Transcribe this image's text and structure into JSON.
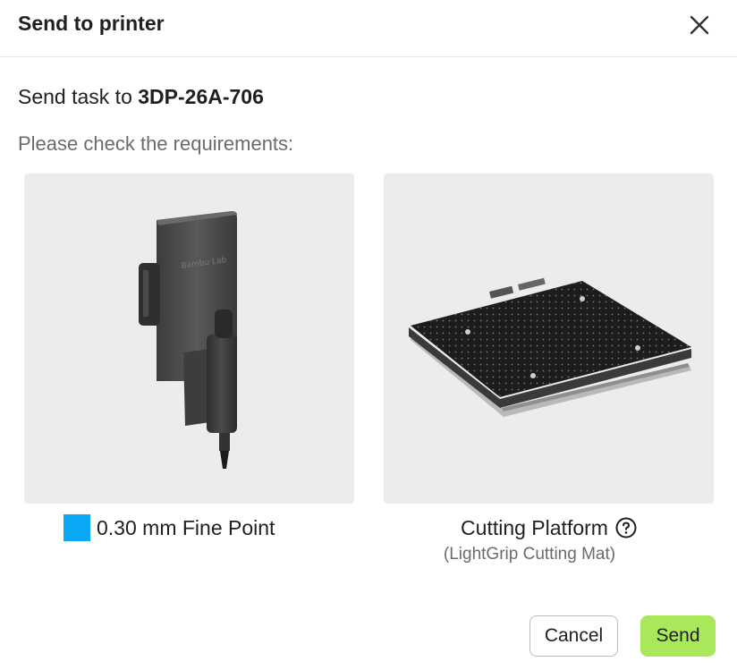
{
  "dialog": {
    "title": "Send to printer",
    "send_prefix": "Send task to ",
    "device_name": "3DP-26A-706",
    "requirements_text": "Please check the requirements:"
  },
  "tool": {
    "label": "0.30 mm Fine Point",
    "swatch_color": "#0aa8f4",
    "icon": "fine-point-tool-image"
  },
  "platform": {
    "label": "Cutting Platform",
    "sub_label": "(LightGrip Cutting Mat)",
    "icon": "cutting-platform-image"
  },
  "buttons": {
    "cancel": "Cancel",
    "send": "Send"
  },
  "colors": {
    "send_button": "#a9e85a",
    "card_background": "#ececec"
  }
}
